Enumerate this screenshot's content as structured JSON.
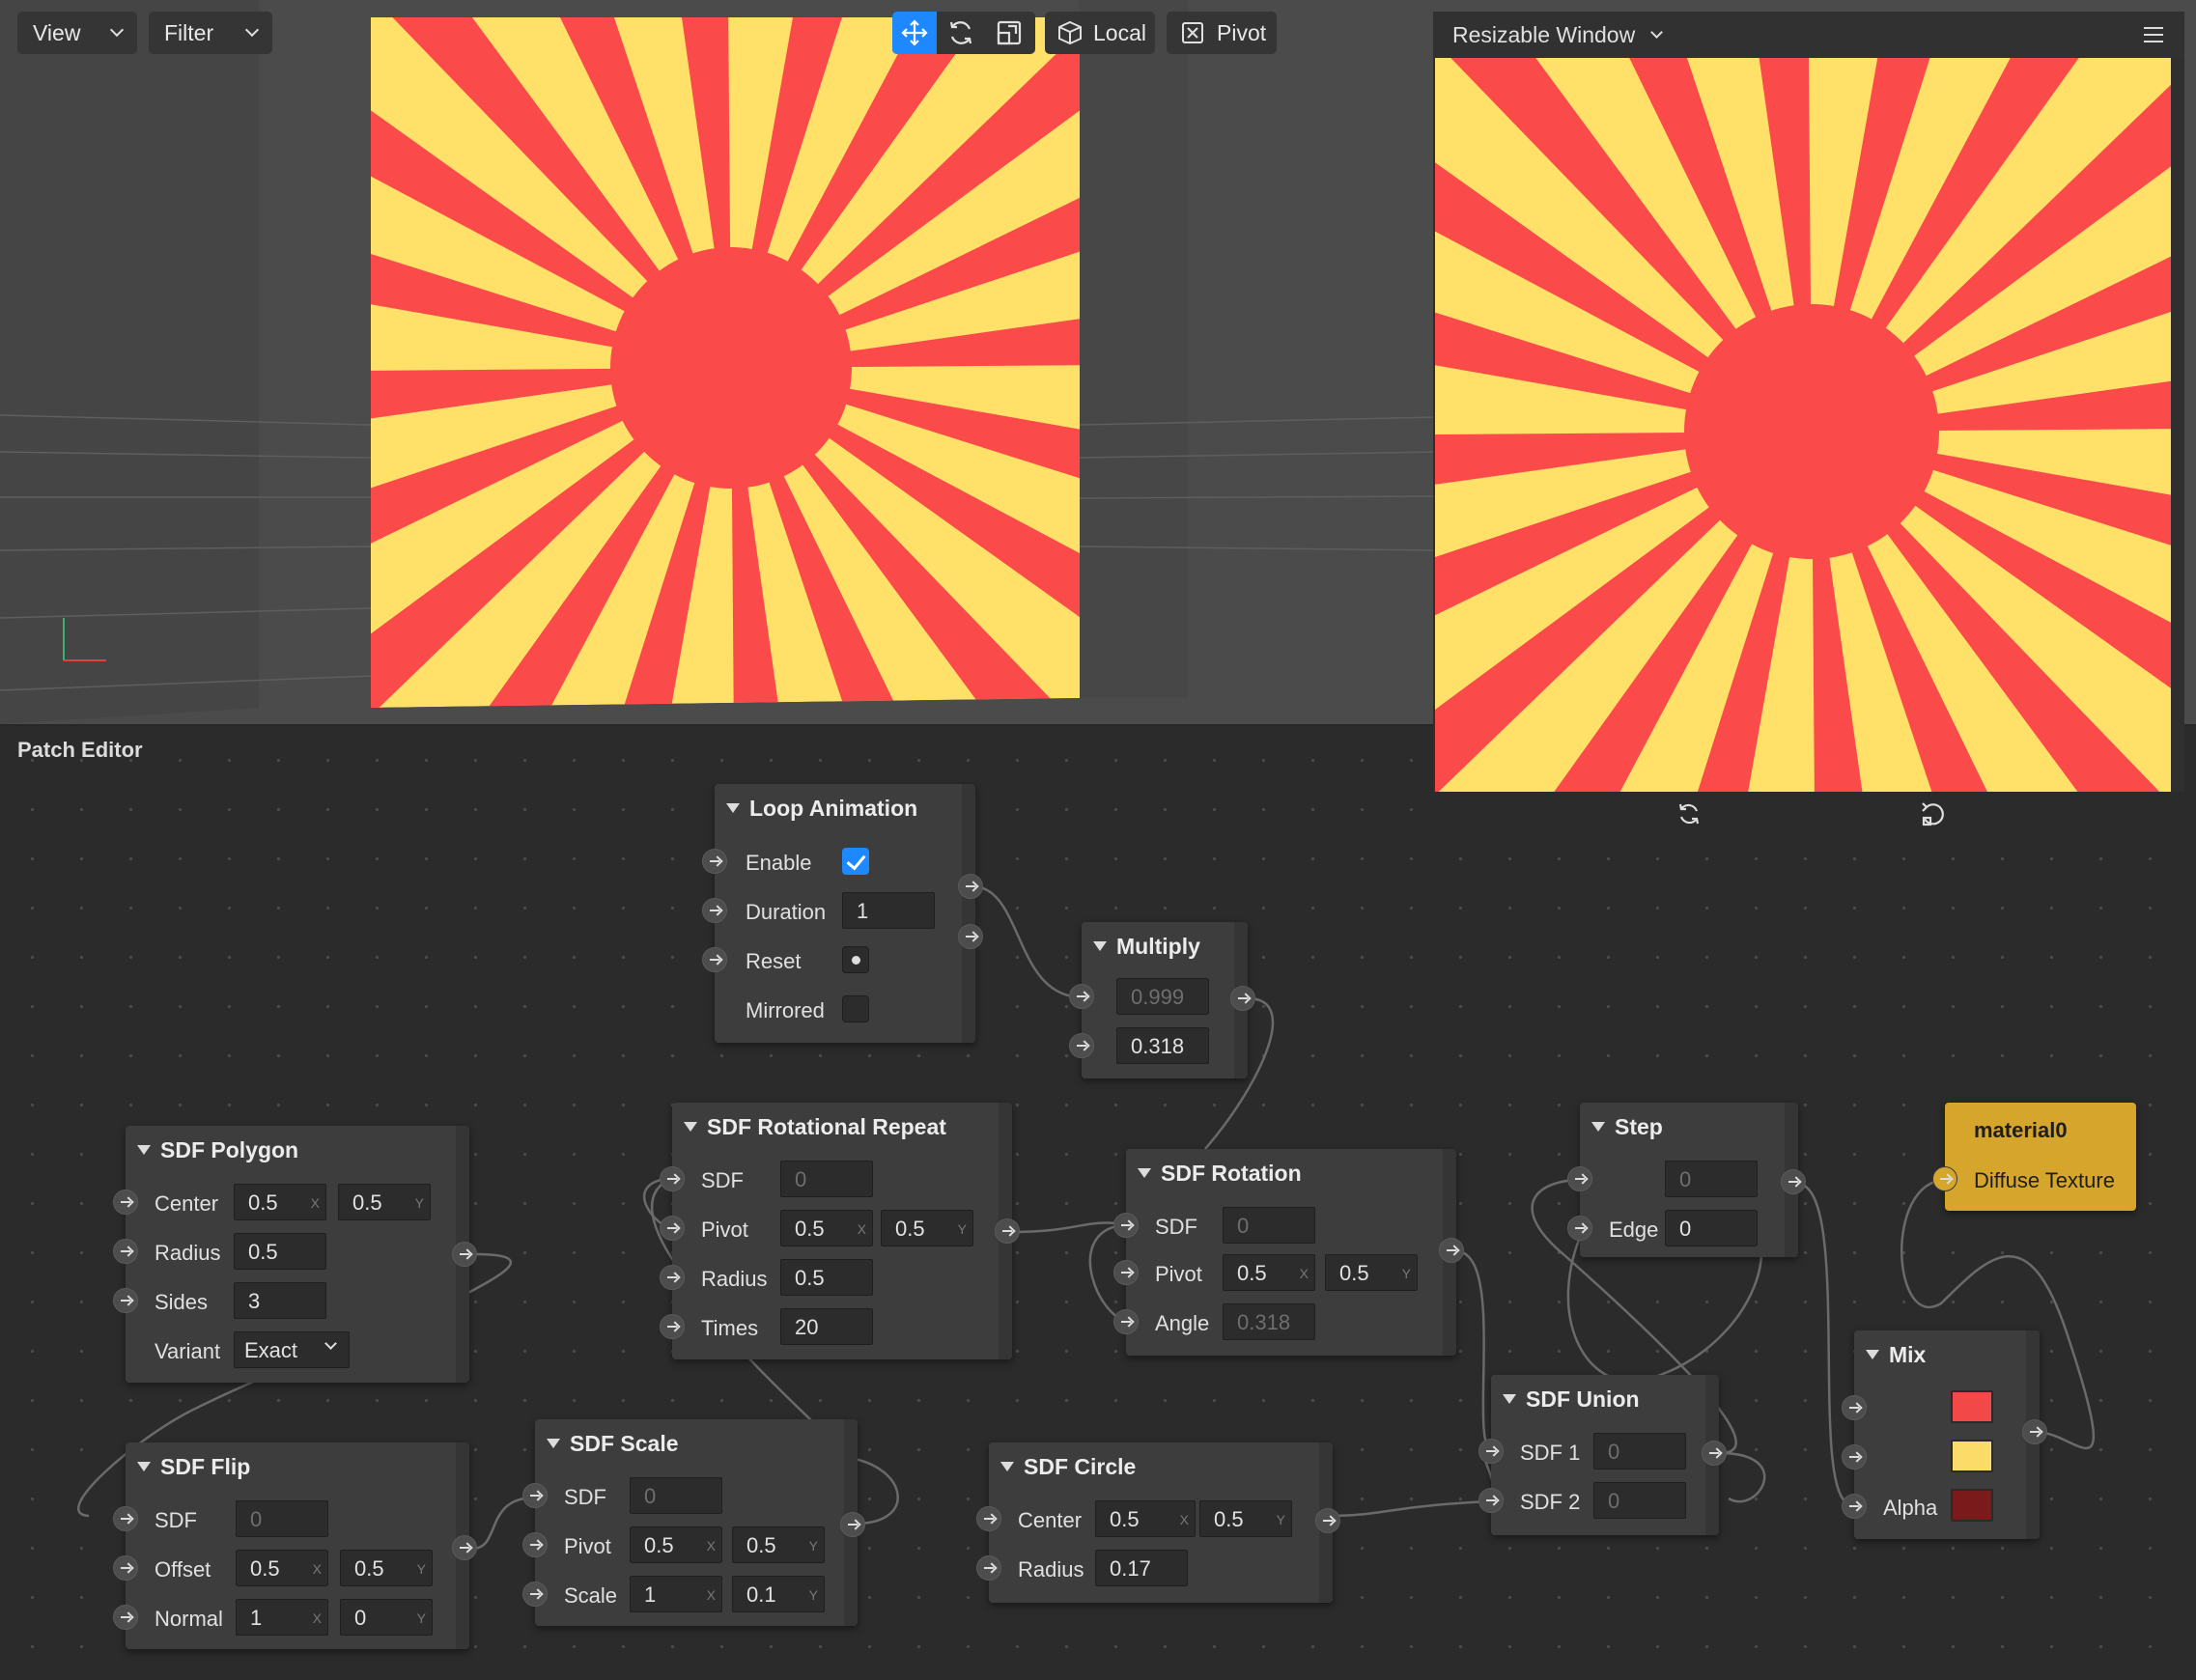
{
  "toolbar": {
    "view_label": "View",
    "filter_label": "Filter",
    "local_label": "Local",
    "pivot_label": "Pivot",
    "icons": [
      "move-icon",
      "rotate-icon",
      "scale-icon",
      "cube-icon",
      "pivot-icon"
    ],
    "accent": "#1e88ff"
  },
  "colors": {
    "sun_red": "#fb4a4a",
    "sun_yellow": "#ffe16a",
    "mix_color_1": "#f24848",
    "mix_color_2": "#fbdc68",
    "mix_alpha": "#7a1a1a"
  },
  "preview": {
    "title": "Resizable Window",
    "menu_icon": "hamburger-icon",
    "footer_icons": [
      "refresh-icon",
      "restart-icon"
    ]
  },
  "patch_editor": {
    "title": "Patch Editor"
  },
  "nodes": {
    "loop_animation": {
      "title": "Loop Animation",
      "enable_label": "Enable",
      "enable_checked": true,
      "duration_label": "Duration",
      "duration_value": "1",
      "reset_label": "Reset",
      "mirrored_label": "Mirrored",
      "mirrored_checked": false
    },
    "multiply": {
      "title": "Multiply",
      "input_a": "0.999",
      "input_b": "0.318"
    },
    "sdf_polygon": {
      "title": "SDF Polygon",
      "center_label": "Center",
      "center_x": "0.5",
      "center_y": "0.5",
      "radius_label": "Radius",
      "radius_value": "0.5",
      "sides_label": "Sides",
      "sides_value": "3",
      "variant_label": "Variant",
      "variant_value": "Exact"
    },
    "sdf_rotational_repeat": {
      "title": "SDF Rotational Repeat",
      "sdf_label": "SDF",
      "sdf_value": "0",
      "pivot_label": "Pivot",
      "pivot_x": "0.5",
      "pivot_y": "0.5",
      "radius_label": "Radius",
      "radius_value": "0.5",
      "times_label": "Times",
      "times_value": "20"
    },
    "sdf_rotation": {
      "title": "SDF Rotation",
      "sdf_label": "SDF",
      "sdf_value": "0",
      "pivot_label": "Pivot",
      "pivot_x": "0.5",
      "pivot_y": "0.5",
      "angle_label": "Angle",
      "angle_value": "0.318"
    },
    "step": {
      "title": "Step",
      "input_value": "0",
      "edge_label": "Edge",
      "edge_value": "0"
    },
    "material": {
      "title": "material0",
      "diffuse_label": "Diffuse Texture"
    },
    "sdf_flip": {
      "title": "SDF Flip",
      "sdf_label": "SDF",
      "sdf_value": "0",
      "offset_label": "Offset",
      "offset_x": "0.5",
      "offset_y": "0.5",
      "normal_label": "Normal",
      "normal_x": "1",
      "normal_y": "0"
    },
    "sdf_scale": {
      "title": "SDF Scale",
      "sdf_label": "SDF",
      "sdf_value": "0",
      "pivot_label": "Pivot",
      "pivot_x": "0.5",
      "pivot_y": "0.5",
      "scale_label": "Scale",
      "scale_x": "1",
      "scale_y": "0.1"
    },
    "sdf_circle": {
      "title": "SDF Circle",
      "center_label": "Center",
      "center_x": "0.5",
      "center_y": "0.5",
      "radius_label": "Radius",
      "radius_value": "0.17"
    },
    "sdf_union": {
      "title": "SDF Union",
      "sdf1_label": "SDF 1",
      "sdf1_value": "0",
      "sdf2_label": "SDF 2",
      "sdf2_value": "0"
    },
    "mix": {
      "title": "Mix",
      "alpha_label": "Alpha"
    }
  },
  "axis_x": "X",
  "axis_y": "Y"
}
